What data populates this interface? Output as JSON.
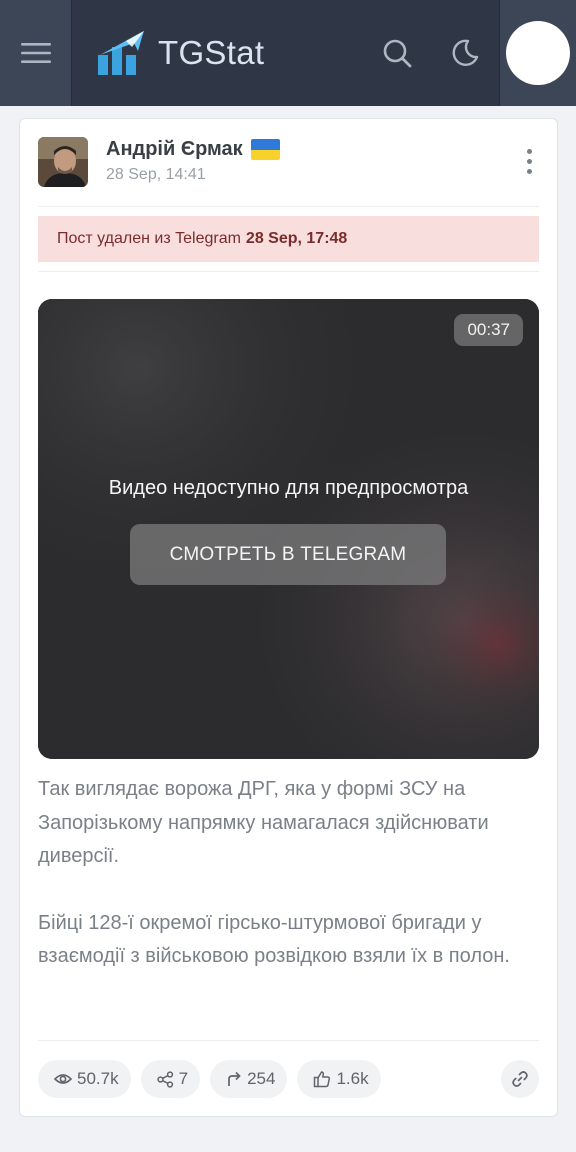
{
  "header": {
    "app_name": "TGStat"
  },
  "post": {
    "channel_name": "Андрій Єрмак",
    "date": "28 Sep, 14:41",
    "deleted_notice": {
      "text": "Пост удален из Telegram",
      "time": "28 Sep, 17:48"
    },
    "video": {
      "duration": "00:37",
      "message": "Видео недоступно для предпросмотра",
      "watch_button": "СМОТРЕТЬ В TELEGRAM"
    },
    "paragraphs": [
      "Так виглядає ворожа ДРГ, яка у формі ЗСУ на Запорізькому напрямку намагалася здійснювати диверсії.",
      "Бійці 128-ї окремої гірсько-штурмової бригади у взаємодії з військовою розвідкою взяли їх в полон."
    ],
    "stats": {
      "views": "50.7k",
      "mentions": "7",
      "forwards": "254",
      "reactions": "1.6k"
    }
  },
  "icons": {
    "menu": "hamburger-icon",
    "search": "search-icon",
    "theme": "moon-icon",
    "more": "kebab-icon",
    "views": "eye-icon",
    "mentions": "share-icon",
    "forwards": "forward-icon",
    "reactions": "thumbs-up-icon",
    "link": "link-icon"
  },
  "colors": {
    "header_bg": "#2f3747",
    "alert_bg": "#f9dede",
    "alert_text": "#7a2c2c",
    "brand": "#3aa3e0"
  }
}
